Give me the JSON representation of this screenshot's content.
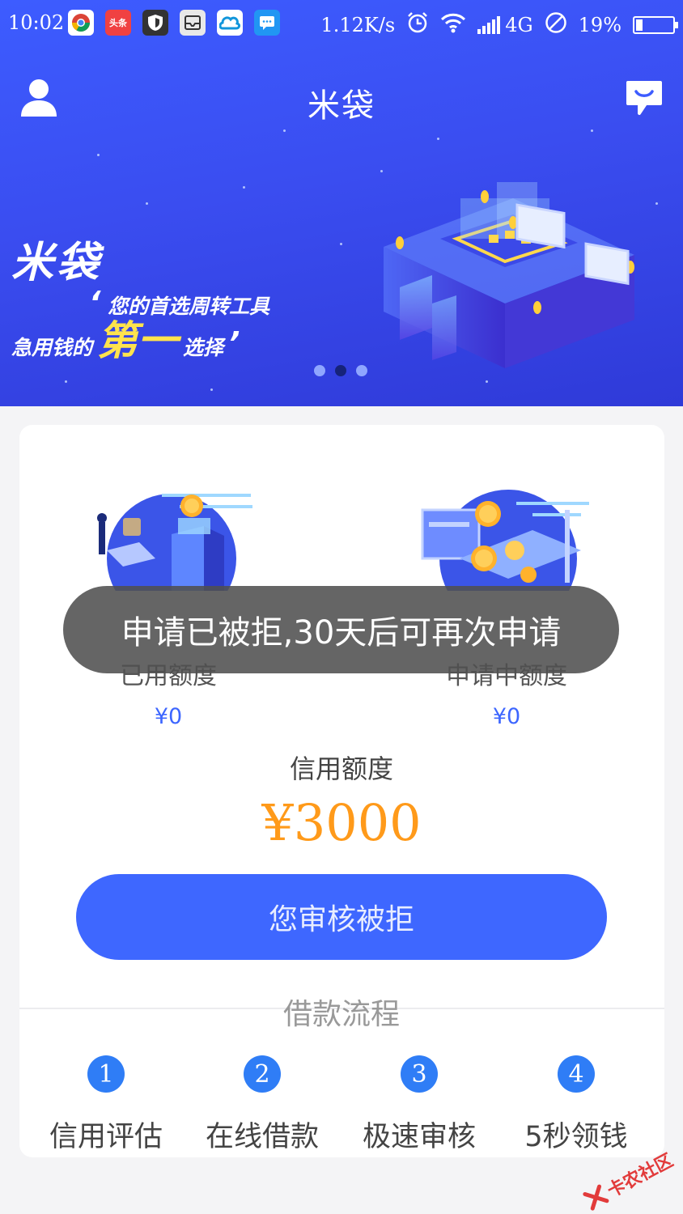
{
  "status_bar": {
    "time": "10:02",
    "apps": [
      "chrome-icon",
      "toutiao-icon",
      "shield-icon",
      "inbox-icon",
      "cloud-icon",
      "message-icon"
    ],
    "toutiao_label": "头条",
    "net_speed": "1.12K/s",
    "network": "4G",
    "battery": "19%",
    "battery_level": 0.19
  },
  "nav": {
    "title": "米袋"
  },
  "banner": {
    "brand": "米袋",
    "line1": "您的首选周转工具",
    "line2_pre": "急用钱的",
    "line2_big": "第一",
    "line2_post": "选择",
    "quote_open": "‘",
    "quote_close": "’",
    "pages": 3,
    "active_page": 2
  },
  "quota": {
    "used_label": "已用额度",
    "used_value": "¥0",
    "pending_label": "申请中额度",
    "pending_value": "¥0",
    "credit_label": "信用额度",
    "credit_value": "¥3000"
  },
  "action": {
    "button_label": "您审核被拒"
  },
  "flow": {
    "title": "借款流程",
    "steps": [
      {
        "num": "1",
        "label": "信用评估"
      },
      {
        "num": "2",
        "label": "在线借款"
      },
      {
        "num": "3",
        "label": "极速审核"
      },
      {
        "num": "4",
        "label": "5秒领钱"
      }
    ]
  },
  "toast": {
    "message": "申请已被拒,30天后可再次申请"
  },
  "watermark": {
    "text": "卡农社区"
  },
  "colors": {
    "primary": "#3e67ff",
    "accent": "#ff9a1a",
    "toast": "#505050"
  }
}
